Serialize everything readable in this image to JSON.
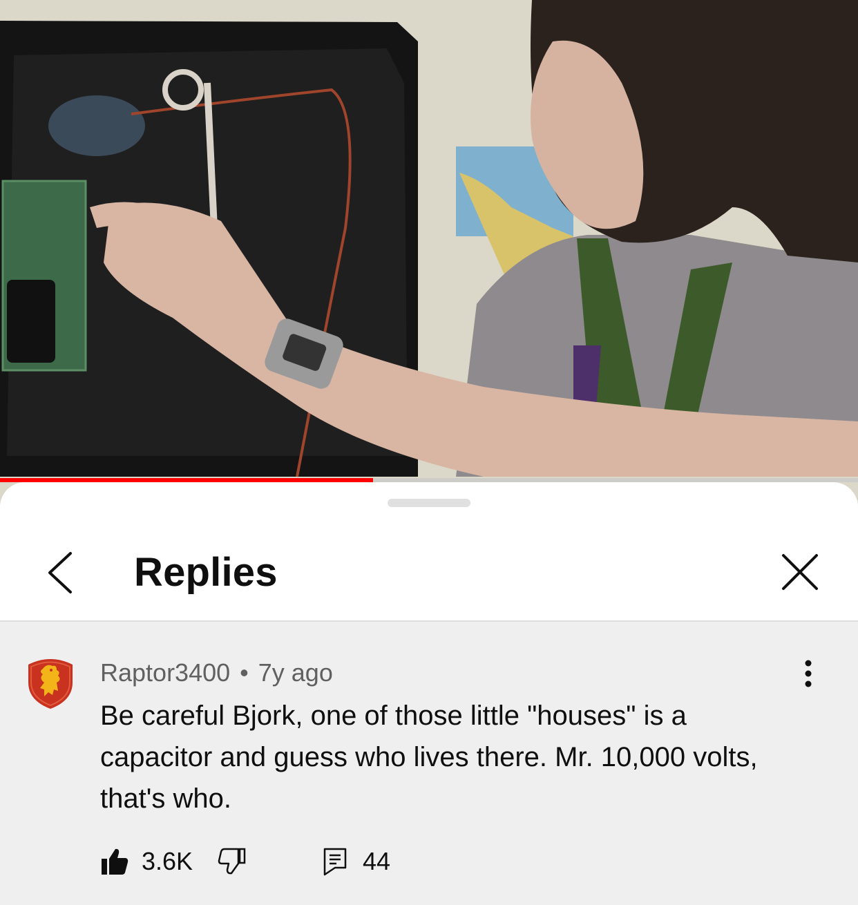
{
  "video": {
    "progress_fraction": 0.435
  },
  "sheet": {
    "title": "Replies"
  },
  "comment": {
    "author": "Raptor3400",
    "separator": "•",
    "age": "7y ago",
    "text": "Be careful Bjork, one of those little \"houses\" is a capacitor and guess who lives there. Mr. 10,000 volts, that's who.",
    "likes": "3.6K",
    "replies": "44"
  },
  "icons": {
    "back": "chevron-left-icon",
    "close": "close-icon",
    "more": "more-vertical-icon",
    "like": "thumbs-up-filled-icon",
    "dislike": "thumbs-down-icon",
    "reply": "comment-icon"
  },
  "colors": {
    "progress": "#ff0000",
    "sheet_bg": "#efefef",
    "header_bg": "#ffffff",
    "avatar_red": "#c8321f",
    "avatar_gold": "#f2b418"
  }
}
